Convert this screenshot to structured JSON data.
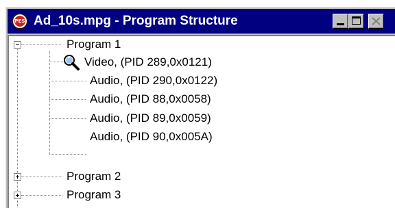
{
  "window": {
    "title": "Ad_10s.mpg - Program Structure",
    "app_icon_text": "PES"
  },
  "tree": {
    "programs": [
      {
        "label": "Program 1",
        "expanded": true,
        "streams": [
          {
            "label": "Video,  (PID 289,0x0121)",
            "icon": "magnifier-icon"
          },
          {
            "label": "Audio,  (PID 290,0x0122)"
          },
          {
            "label": "Audio,  (PID 88,0x0058)"
          },
          {
            "label": "Audio,  (PID 89,0x0059)"
          },
          {
            "label": "Audio,  (PID 90,0x005A)"
          }
        ]
      },
      {
        "label": "Program 2",
        "expanded": false
      },
      {
        "label": "Program 3",
        "expanded": false
      }
    ]
  },
  "colors": {
    "titlebar": "#000080",
    "window_face": "#c0c0c0",
    "tree_background": "#ffffff"
  }
}
